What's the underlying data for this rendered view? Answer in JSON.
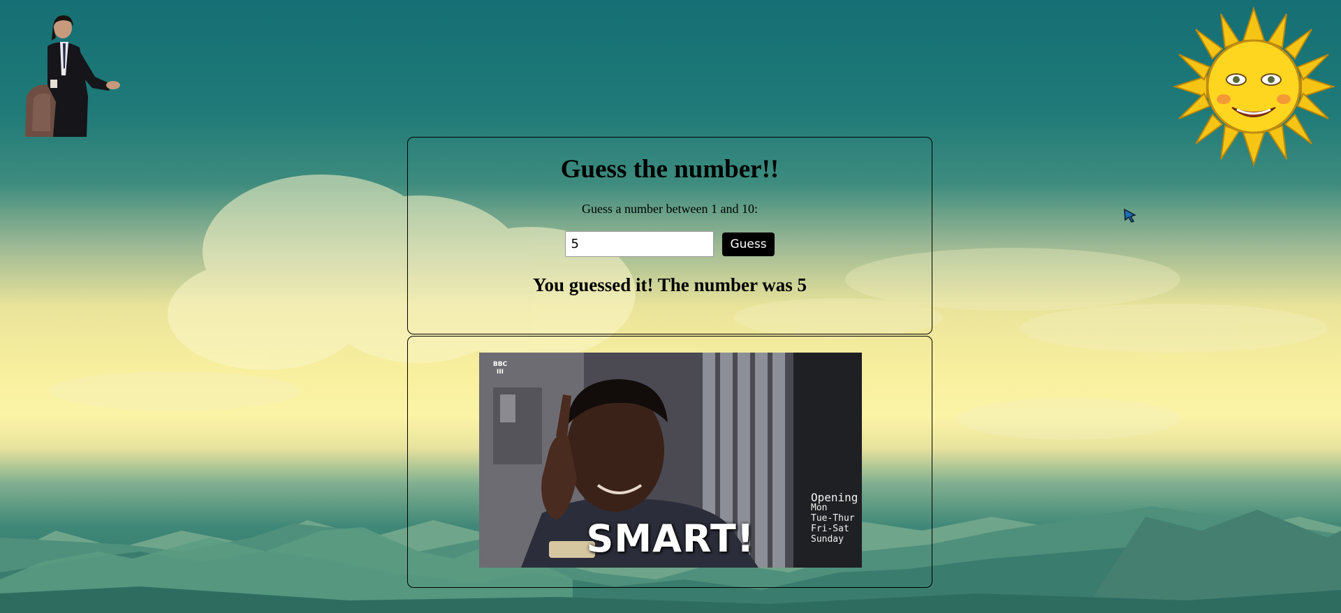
{
  "game": {
    "title": "Guess the number!!",
    "prompt": "Guess a number between 1 and 10:",
    "input_value": "5",
    "button_label": "Guess",
    "result": "You guessed it! The number was 5"
  },
  "meme": {
    "caption": "SMART!",
    "channel_badge": "BBC III",
    "sign_lines": [
      "Opening",
      "Mon",
      "Tue-Thur",
      "Fri-Sat",
      "Sunday"
    ]
  },
  "decorations": {
    "left_figure": "confused-man-figure",
    "right_figure": "smiling-sun",
    "cursor": "mouse-cursor-icon"
  },
  "colors": {
    "sky_top": "#156f74",
    "sky_glow": "#f8ef9e",
    "panel_border": "#000000",
    "button_bg": "#000000",
    "button_text": "#ffffff"
  }
}
